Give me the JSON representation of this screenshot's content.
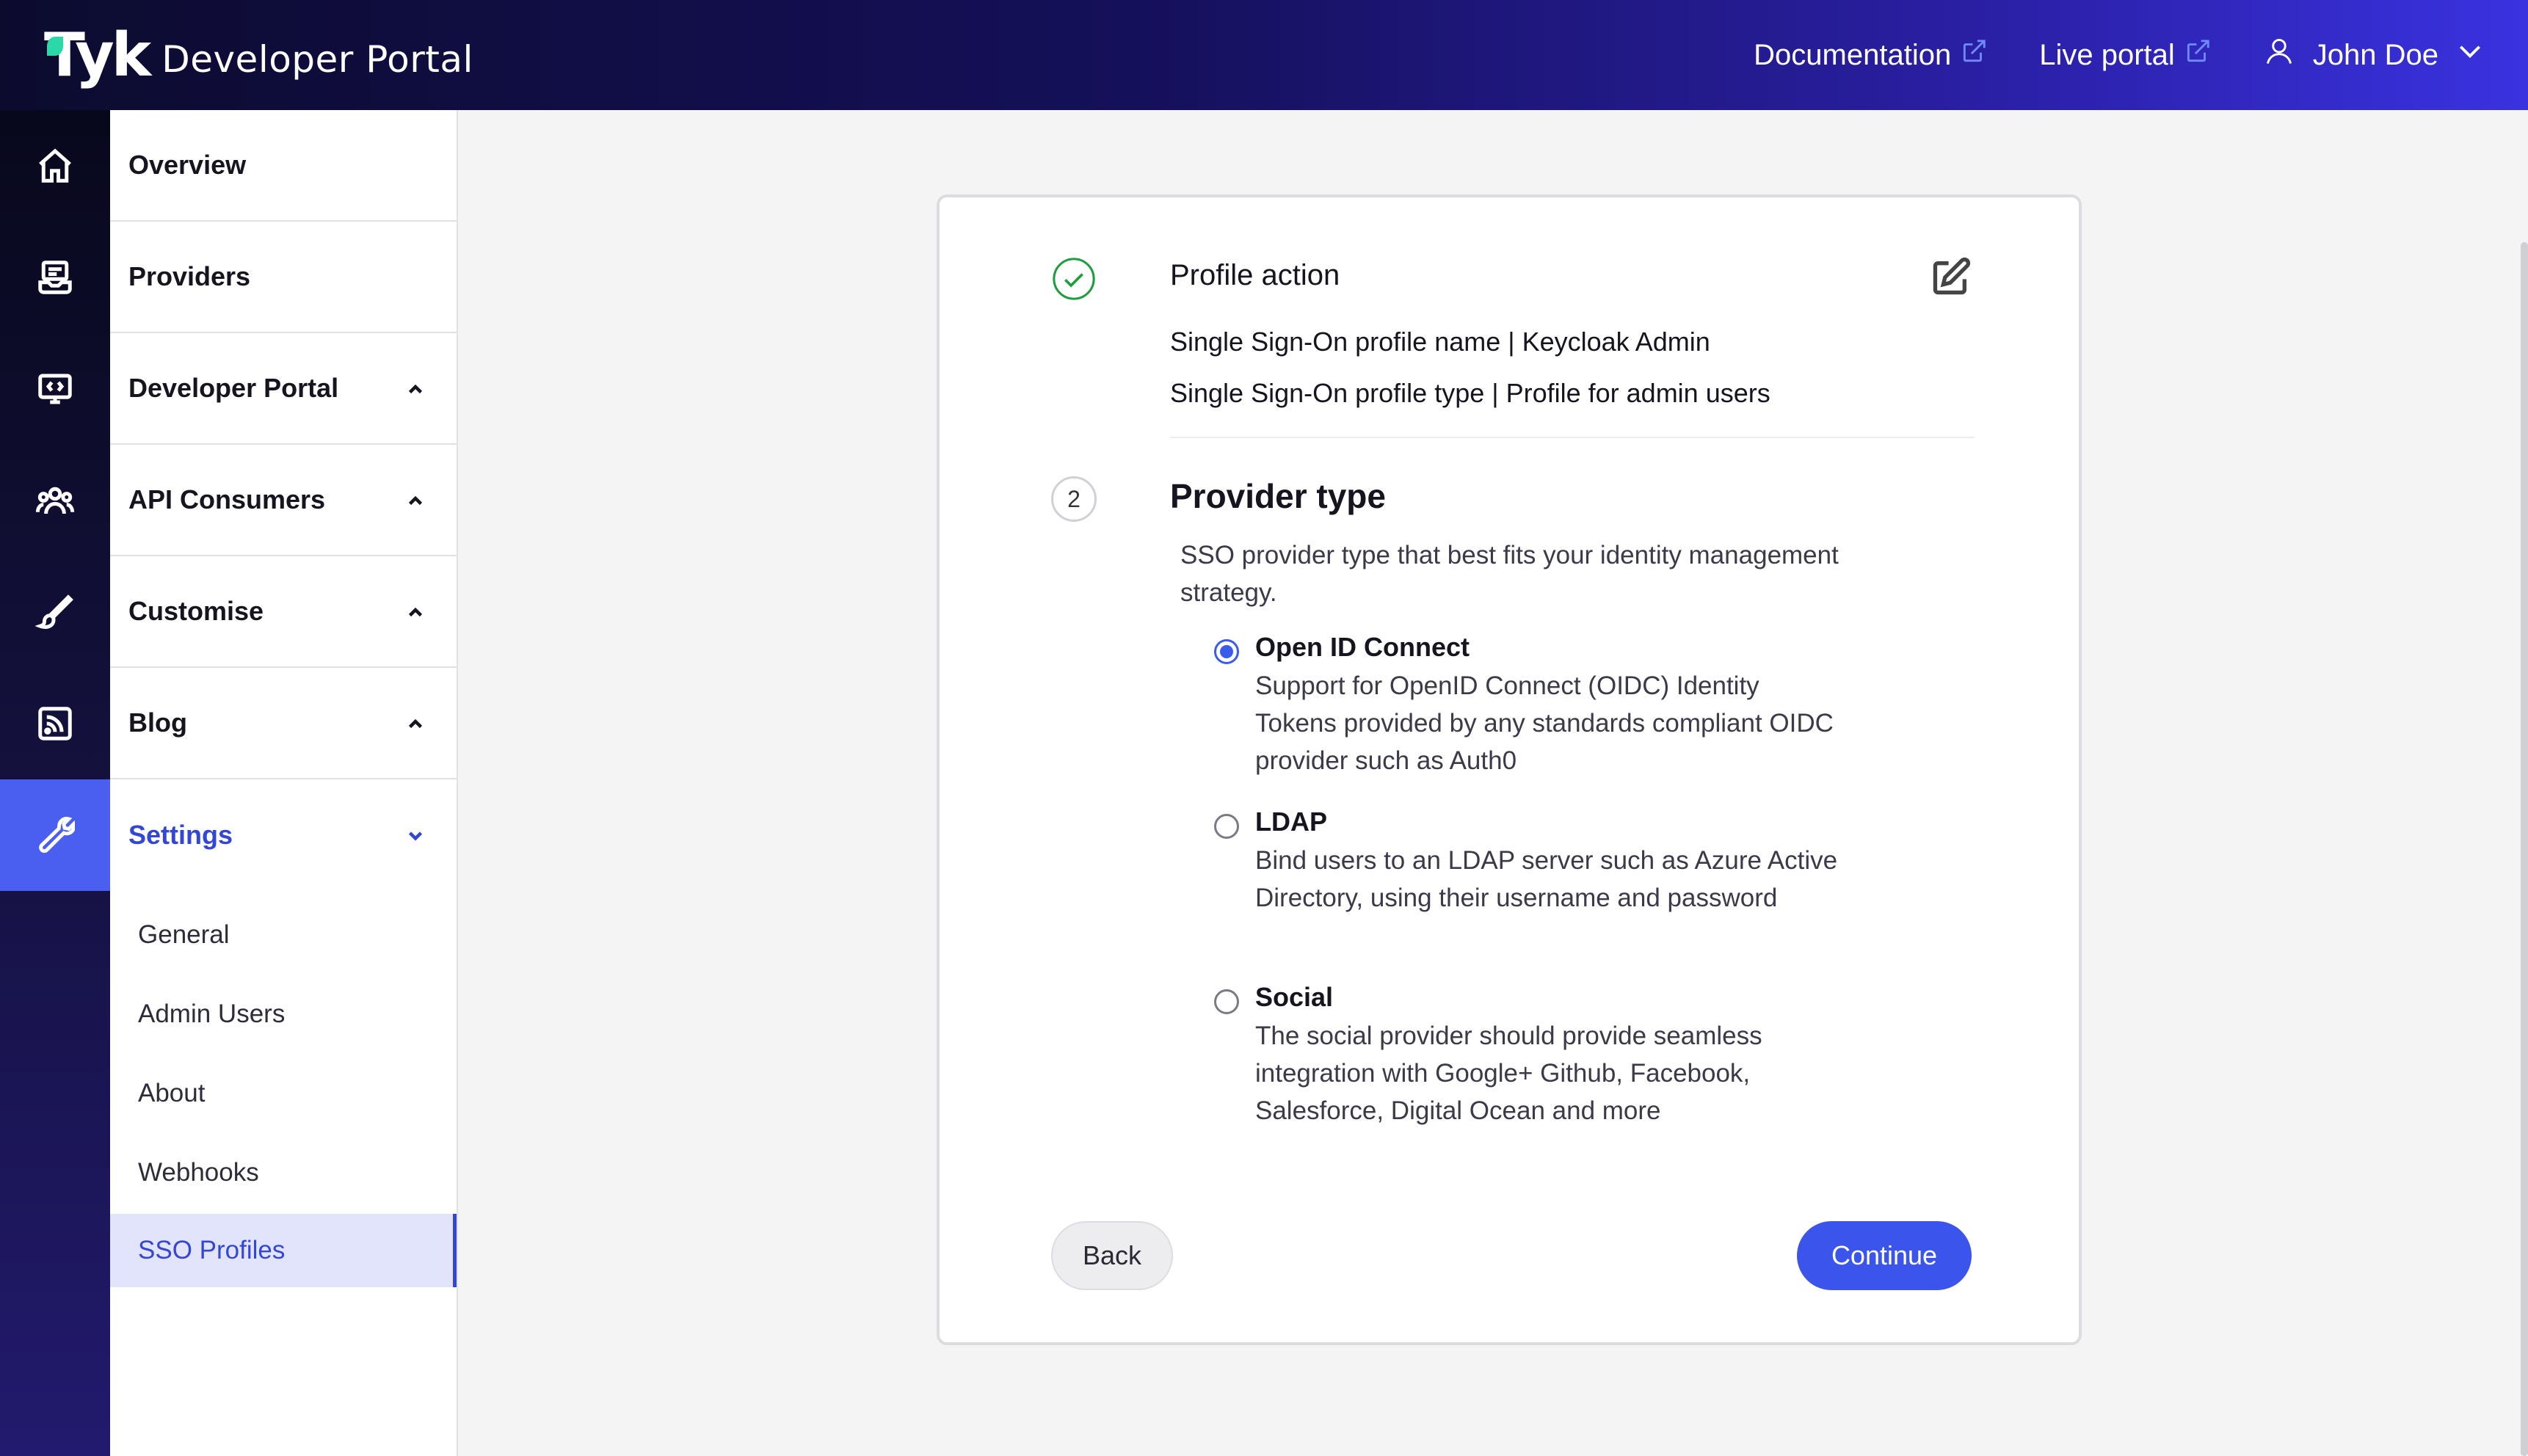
{
  "header": {
    "logo_text": "Tyk",
    "app_title": "Developer Portal",
    "links": [
      {
        "label": "Documentation",
        "icon": "external-link-icon"
      },
      {
        "label": "Live portal",
        "icon": "external-link-icon"
      }
    ],
    "user": {
      "name": "John Doe",
      "icon": "user-icon",
      "menu_icon": "chevron-down-icon"
    }
  },
  "rail": {
    "icons": [
      "home-icon",
      "providers-icon",
      "developer-portal-icon",
      "api-consumers-icon",
      "customise-brush-icon",
      "blog-rss-icon",
      "settings-wrench-icon"
    ],
    "active": "settings-wrench-icon"
  },
  "menu": {
    "items": [
      {
        "label": "Overview"
      },
      {
        "label": "Providers"
      },
      {
        "label": "Developer Portal"
      },
      {
        "label": "API Consumers"
      },
      {
        "label": "Customise"
      },
      {
        "label": "Blog"
      },
      {
        "label": "Settings"
      }
    ],
    "settings_sub": [
      {
        "label": "General"
      },
      {
        "label": "Admin Users"
      },
      {
        "label": "About"
      },
      {
        "label": "Webhooks"
      },
      {
        "label": "SSO Profiles"
      }
    ],
    "active_sub": "SSO Profiles"
  },
  "wizard": {
    "step1": {
      "title": "Profile action",
      "summary_name": "Single Sign-On profile name | Keycloak Admin",
      "summary_type": "Single Sign-On profile type | Profile for admin users"
    },
    "step2": {
      "number": "2",
      "title": "Provider type",
      "description": "SSO provider type that best fits your identity management strategy.",
      "options": [
        {
          "title": "Open ID Connect",
          "description": "Support for OpenID Connect (OIDC) Identity Tokens provided by any standards compliant OIDC provider such as Auth0",
          "selected": true
        },
        {
          "title": "LDAP",
          "description": "Bind users to an LDAP server such as Azure Active Directory, using their username and password",
          "selected": false
        },
        {
          "title": "Social",
          "description": "The social provider should provide seamless integration with Google+ Github, Facebook, Salesforce, Digital Ocean and more",
          "selected": false
        }
      ]
    },
    "buttons": {
      "back": "Back",
      "continue": "Continue"
    }
  },
  "colors": {
    "accent": "#3a54ec",
    "active_menu_text": "#3347d4",
    "success_check": "#1f9d3f"
  }
}
